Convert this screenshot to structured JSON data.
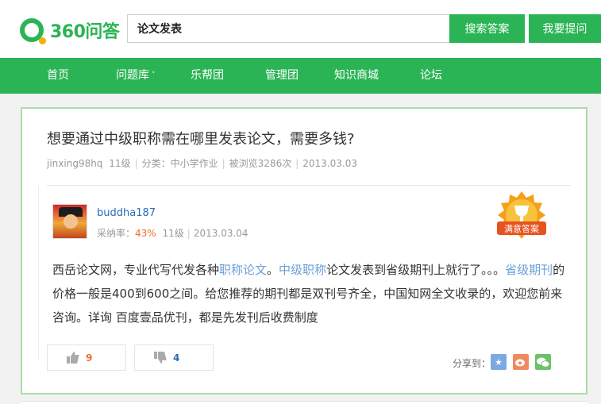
{
  "header": {
    "logo_text": "360问答",
    "search_value": "论文发表",
    "search_button": "搜索答案",
    "ask_button": "我要提问"
  },
  "nav": {
    "items": [
      {
        "label": "首页"
      },
      {
        "label": "问题库",
        "caret": "˅"
      },
      {
        "label": "乐帮团"
      },
      {
        "label": "管理团"
      },
      {
        "label": "知识商城"
      },
      {
        "label": "论坛"
      }
    ]
  },
  "question": {
    "title": "想要通过中级职称需在哪里发表论文，需要多钱?",
    "user": "jinxing98hq",
    "level": "11级",
    "category_label": "分类：",
    "category": "中小学作业",
    "views": "被浏览3286次",
    "date": "2013.03.03"
  },
  "answer": {
    "user": "buddha187",
    "accept_label": "采纳率：",
    "accept_rate": "43%",
    "level": "11级",
    "date": "2013.03.04",
    "badge_text": "满意答案",
    "body_parts": [
      {
        "text": "西岳论文网，专业代写代发各种",
        "hl": false
      },
      {
        "text": "职称论文",
        "hl": true
      },
      {
        "text": "。",
        "hl": false
      },
      {
        "text": "中级职称",
        "hl": true
      },
      {
        "text": "论文发表到省级期刊上就行了。。。",
        "hl": false
      },
      {
        "text": "省级期刊",
        "hl": true
      },
      {
        "text": "的价格一般是400到600之间。给您推荐的期刊都是双刊号齐全，中国知网全文收录的，欢迎您前来咨询。详询  百度壹品优刊，都是先发刊后收费制度",
        "hl": false
      }
    ],
    "up_votes": "9",
    "down_votes": "4",
    "share_label": "分享到：",
    "share_targets": [
      {
        "icon": "star-icon",
        "color": "#7aa9e3"
      },
      {
        "icon": "weibo-icon",
        "color": "#f08a5d"
      },
      {
        "icon": "wechat-icon",
        "color": "#6cc26a"
      }
    ]
  }
}
